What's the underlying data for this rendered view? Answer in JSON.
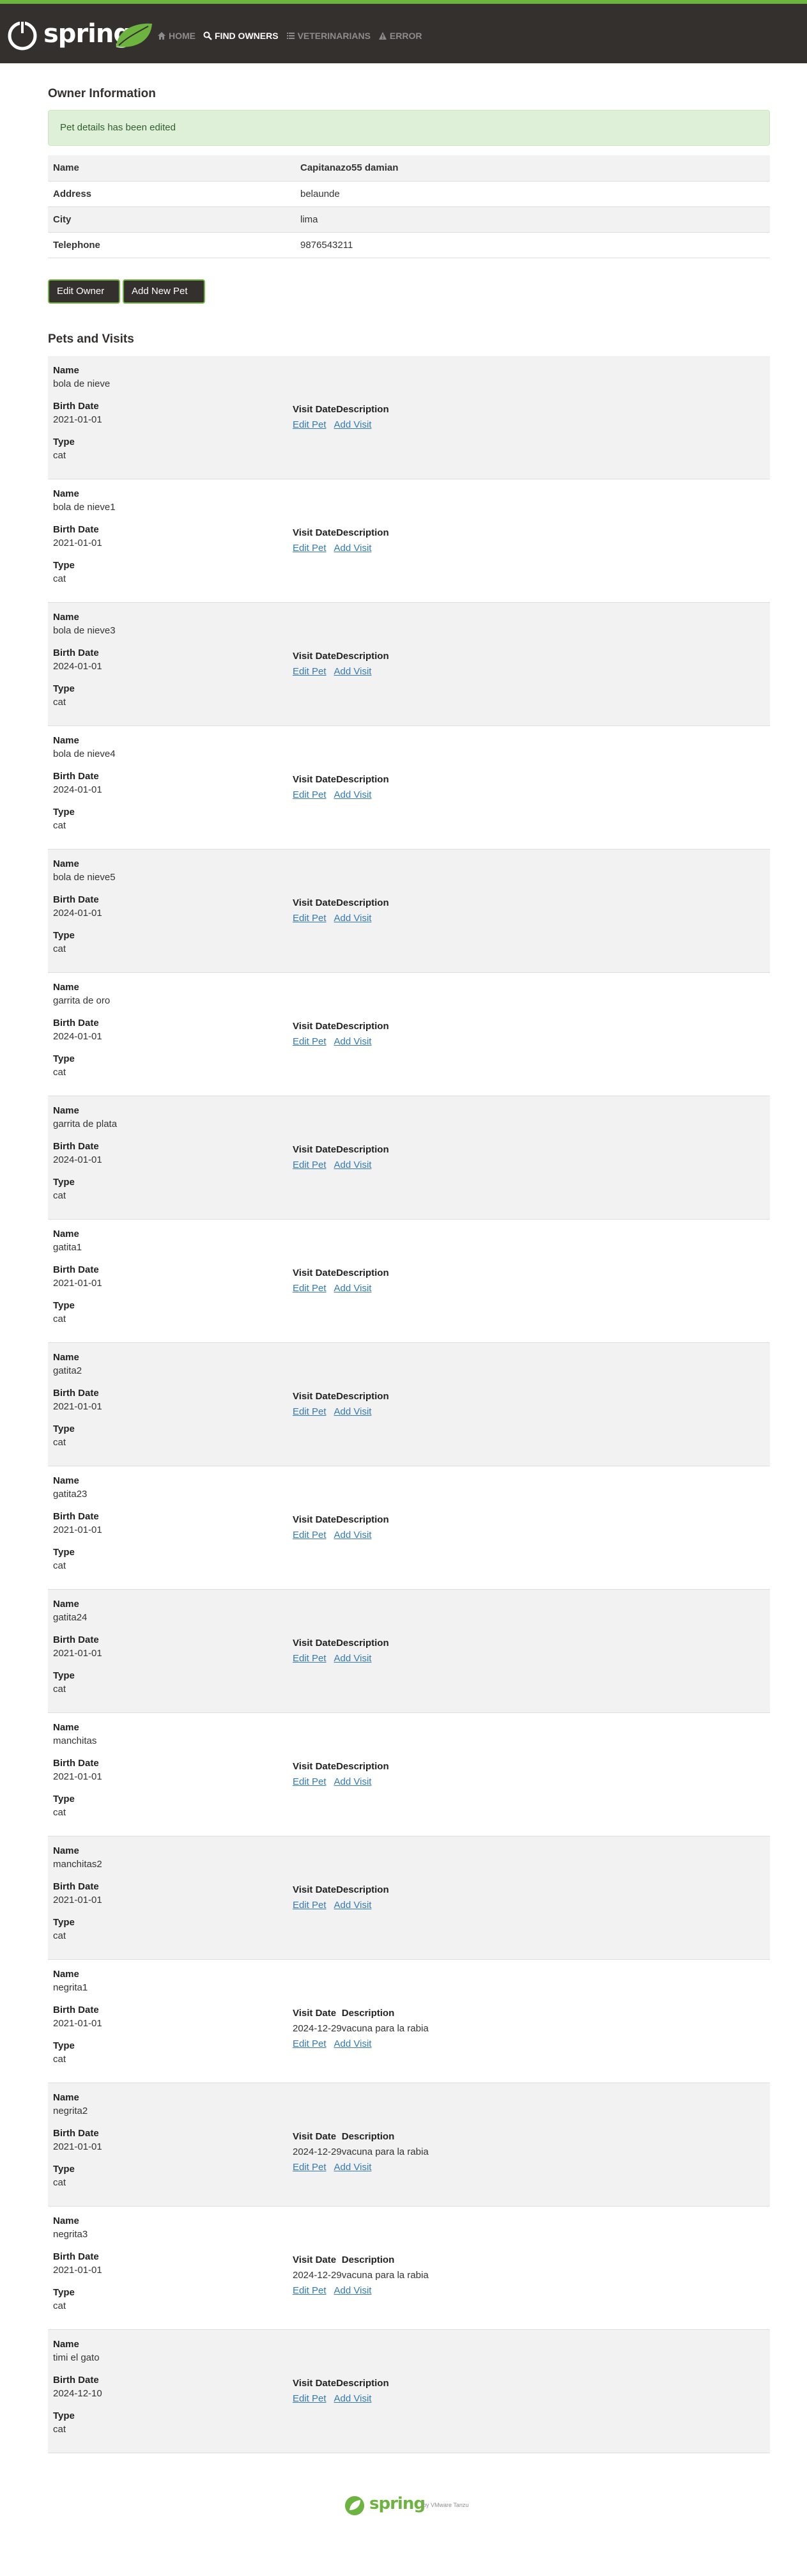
{
  "brand": {
    "name": "spring",
    "accent": "#6db33f",
    "bar": "#34302d"
  },
  "nav": [
    {
      "label": "HOME",
      "icon": "home-icon"
    },
    {
      "label": "FIND OWNERS",
      "icon": "search-icon",
      "active": true
    },
    {
      "label": "VETERINARIANS",
      "icon": "list-icon"
    },
    {
      "label": "ERROR",
      "icon": "warning-icon"
    }
  ],
  "owner": {
    "heading": "Owner Information",
    "alert": "Pet details has been edited",
    "rows": [
      {
        "label": "Name",
        "value": "Capitanazo55 damian"
      },
      {
        "label": "Address",
        "value": "belaunde"
      },
      {
        "label": "City",
        "value": "lima"
      },
      {
        "label": "Telephone",
        "value": "9876543211"
      }
    ],
    "edit_label": "Edit Owner",
    "add_pet_label": "Add New Pet"
  },
  "pets_heading": "Pets and Visits",
  "pet_labels": {
    "name": "Name",
    "birth": "Birth Date",
    "type": "Type",
    "visit_date": "Visit Date",
    "description": "Description",
    "edit_pet": "Edit Pet",
    "add_visit": "Add Visit"
  },
  "pets": [
    {
      "name": "bola de nieve",
      "birth": "2021-01-01",
      "type": "cat",
      "visits": []
    },
    {
      "name": "bola de nieve1",
      "birth": "2021-01-01",
      "type": "cat",
      "visits": []
    },
    {
      "name": "bola de nieve3",
      "birth": "2024-01-01",
      "type": "cat",
      "visits": []
    },
    {
      "name": "bola de nieve4",
      "birth": "2024-01-01",
      "type": "cat",
      "visits": []
    },
    {
      "name": "bola de nieve5",
      "birth": "2024-01-01",
      "type": "cat",
      "visits": []
    },
    {
      "name": "garrita de oro",
      "birth": "2024-01-01",
      "type": "cat",
      "visits": []
    },
    {
      "name": "garrita de plata",
      "birth": "2024-01-01",
      "type": "cat",
      "visits": []
    },
    {
      "name": "gatita1",
      "birth": "2021-01-01",
      "type": "cat",
      "visits": []
    },
    {
      "name": "gatita2",
      "birth": "2021-01-01",
      "type": "cat",
      "visits": []
    },
    {
      "name": "gatita23",
      "birth": "2021-01-01",
      "type": "cat",
      "visits": []
    },
    {
      "name": "gatita24",
      "birth": "2021-01-01",
      "type": "cat",
      "visits": []
    },
    {
      "name": "manchitas",
      "birth": "2021-01-01",
      "type": "cat",
      "visits": []
    },
    {
      "name": "manchitas2",
      "birth": "2021-01-01",
      "type": "cat",
      "visits": []
    },
    {
      "name": "negrita1",
      "birth": "2021-01-01",
      "type": "cat",
      "visits": [
        {
          "date": "2024-12-29",
          "description": "vacuna para la rabia"
        }
      ]
    },
    {
      "name": "negrita2",
      "birth": "2021-01-01",
      "type": "cat",
      "visits": [
        {
          "date": "2024-12-29",
          "description": "vacuna para la rabia"
        }
      ]
    },
    {
      "name": "negrita3",
      "birth": "2021-01-01",
      "type": "cat",
      "visits": [
        {
          "date": "2024-12-29",
          "description": "vacuna para la rabia"
        }
      ]
    },
    {
      "name": "timi el gato",
      "birth": "2024-12-10",
      "type": "cat",
      "visits": []
    }
  ],
  "footer": {
    "logo": "spring",
    "by": "by VMware Tanzu"
  }
}
